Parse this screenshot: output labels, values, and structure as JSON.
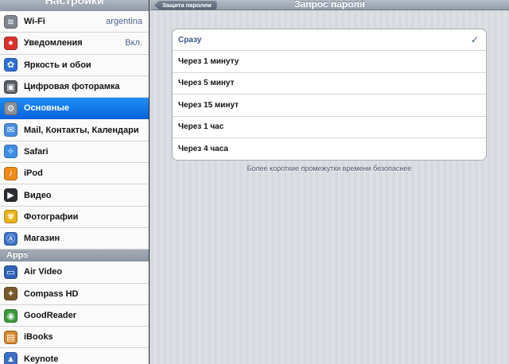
{
  "sidebar": {
    "title": "Настройки",
    "items": [
      {
        "label": "Wi-Fi",
        "value": "argentina",
        "icon": "wifi-icon",
        "color": "#7f868f",
        "glyph": "≋"
      },
      {
        "label": "Уведомления",
        "value": "Вкл.",
        "icon": "notifications-icon",
        "color": "#d8342b",
        "glyph": "●"
      },
      {
        "label": "Яркость и обои",
        "value": "",
        "icon": "brightness-icon",
        "color": "#2f6fd6",
        "glyph": "✿"
      },
      {
        "label": "Цифровая фоторамка",
        "value": "",
        "icon": "photo-frame-icon",
        "color": "#5a5f66",
        "glyph": "▣"
      },
      {
        "label": "Основные",
        "value": "",
        "icon": "general-gear-icon",
        "color": "#8a9099",
        "glyph": "⚙"
      },
      {
        "label": "Mail, Контакты, Календари",
        "value": "",
        "icon": "mail-icon",
        "color": "#4a8fe0",
        "glyph": "✉"
      },
      {
        "label": "Safari",
        "value": "",
        "icon": "safari-compass-icon",
        "color": "#3d8fe6",
        "glyph": "✧"
      },
      {
        "label": "iPod",
        "value": "",
        "icon": "ipod-music-icon",
        "color": "#f08a18",
        "glyph": "♪"
      },
      {
        "label": "Видео",
        "value": "",
        "icon": "video-icon",
        "color": "#2a2d32",
        "glyph": "▶"
      },
      {
        "label": "Фотографии",
        "value": "",
        "icon": "photos-sunflower-icon",
        "color": "#e9b318",
        "glyph": "✾"
      },
      {
        "label": "Магазин",
        "value": "",
        "icon": "store-icon",
        "color": "#3b72c9",
        "glyph": "Ⓐ"
      }
    ],
    "apps_header": "Apps",
    "apps": [
      {
        "label": "Air Video",
        "icon": "air-video-icon",
        "color": "#2e63b8",
        "glyph": "▭"
      },
      {
        "label": "Compass HD",
        "icon": "compass-hd-icon",
        "color": "#7a5a2a",
        "glyph": "✦"
      },
      {
        "label": "GoodReader",
        "icon": "goodreader-icon",
        "color": "#3b9a3b",
        "glyph": "◉"
      },
      {
        "label": "iBooks",
        "icon": "ibooks-icon",
        "color": "#d4892c",
        "glyph": "▤"
      },
      {
        "label": "Keynote",
        "icon": "keynote-icon",
        "color": "#3a6fc4",
        "glyph": "▲"
      }
    ]
  },
  "nav": {
    "back_label": "Защита паролем",
    "title": "Запрос пароля"
  },
  "options": [
    {
      "label": "Сразу",
      "selected": true
    },
    {
      "label": "Через 1 минуту",
      "selected": false
    },
    {
      "label": "Через 5 минут",
      "selected": false
    },
    {
      "label": "Через 15 минут",
      "selected": false
    },
    {
      "label": "Через 1 час",
      "selected": false
    },
    {
      "label": "Через 4 часа",
      "selected": false
    }
  ],
  "check_glyph": "✓",
  "footer": "Более короткие промежутки времени безопаснее",
  "selected_sidebar_index": 4,
  "colors": {
    "accent": "#0a63df",
    "selected_text": "#385487"
  }
}
